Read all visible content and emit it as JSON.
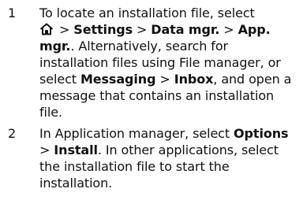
{
  "steps": [
    {
      "number": "1",
      "icon": "home-icon",
      "sep1": " > ",
      "settings": "Settings",
      "sep2": " > ",
      "data_mgr": "Data mgr.",
      "sep3": " > ",
      "app_mgr": "App. mgr.",
      "lead": "To locate an installation file, select",
      "middle": ". Alternatively, search for installation files using File manager, or select ",
      "messaging": "Messaging",
      "sep4": " > ",
      "inbox": "Inbox",
      "tail": ", and open a message that contains an installation file."
    },
    {
      "number": "2",
      "lead": "In Application manager, select ",
      "options": "Options",
      "sep": " > ",
      "install": "Install",
      "tail": ". In other applications, select the installation file to start the installation."
    }
  ]
}
